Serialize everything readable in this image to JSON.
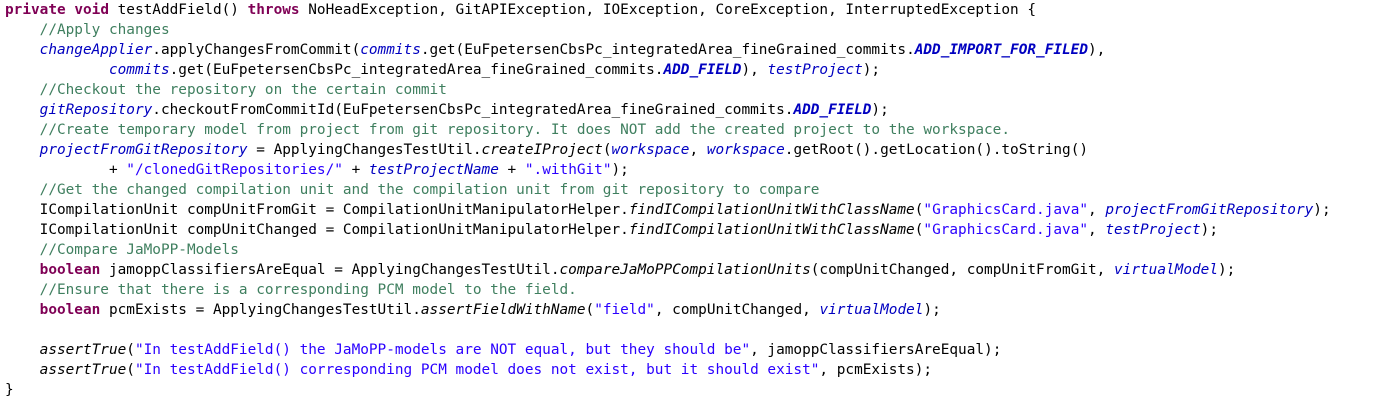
{
  "code_lines": [
    [
      [
        "kw",
        "private"
      ],
      [
        "pl",
        " "
      ],
      [
        "kw",
        "void"
      ],
      [
        "pl",
        " testAddField() "
      ],
      [
        "kw",
        "throws"
      ],
      [
        "pl",
        " NoHeadException, GitAPIException, IOException, CoreException, InterruptedException {"
      ]
    ],
    [
      [
        "pl",
        "    "
      ],
      [
        "cm",
        "//Apply changes"
      ]
    ],
    [
      [
        "pl",
        "    "
      ],
      [
        "fd",
        "changeApplier"
      ],
      [
        "pl",
        ".applyChangesFromCommit("
      ],
      [
        "fd",
        "commits"
      ],
      [
        "pl",
        ".get(EuFpetersenCbsPc_integratedArea_fineGrained_commits."
      ],
      [
        "sf",
        "ADD_IMPORT_FOR_FILED"
      ],
      [
        "pl",
        "),"
      ]
    ],
    [
      [
        "pl",
        "            "
      ],
      [
        "fd",
        "commits"
      ],
      [
        "pl",
        ".get(EuFpetersenCbsPc_integratedArea_fineGrained_commits."
      ],
      [
        "sf",
        "ADD_FIELD"
      ],
      [
        "pl",
        "), "
      ],
      [
        "fd",
        "testProject"
      ],
      [
        "pl",
        ");"
      ]
    ],
    [
      [
        "pl",
        "    "
      ],
      [
        "cm",
        "//Checkout the repository on the certain commit"
      ]
    ],
    [
      [
        "pl",
        "    "
      ],
      [
        "fd",
        "gitRepository"
      ],
      [
        "pl",
        ".checkoutFromCommitId(EuFpetersenCbsPc_integratedArea_fineGrained_commits."
      ],
      [
        "sf",
        "ADD_FIELD"
      ],
      [
        "pl",
        ");"
      ]
    ],
    [
      [
        "pl",
        "    "
      ],
      [
        "cm",
        "//Create temporary model from project from git repository. It does NOT add the created project to the workspace."
      ]
    ],
    [
      [
        "pl",
        "    "
      ],
      [
        "fd",
        "projectFromGitRepository"
      ],
      [
        "pl",
        " = ApplyingChangesTestUtil."
      ],
      [
        "sm",
        "createIProject"
      ],
      [
        "pl",
        "("
      ],
      [
        "fd",
        "workspace"
      ],
      [
        "pl",
        ", "
      ],
      [
        "fd",
        "workspace"
      ],
      [
        "pl",
        ".getRoot().getLocation().toString()"
      ]
    ],
    [
      [
        "pl",
        "            + "
      ],
      [
        "st",
        "\"/clonedGitRepositories/\""
      ],
      [
        "pl",
        " + "
      ],
      [
        "fd",
        "testProjectName"
      ],
      [
        "pl",
        " + "
      ],
      [
        "st",
        "\".withGit\""
      ],
      [
        "pl",
        ");"
      ]
    ],
    [
      [
        "pl",
        "    "
      ],
      [
        "cm",
        "//Get the changed compilation unit and the compilation unit from git repository to compare"
      ]
    ],
    [
      [
        "pl",
        "    ICompilationUnit compUnitFromGit = CompilationUnitManipulatorHelper."
      ],
      [
        "sm",
        "findICompilationUnitWithClassName"
      ],
      [
        "pl",
        "("
      ],
      [
        "st",
        "\"GraphicsCard.java\""
      ],
      [
        "pl",
        ", "
      ],
      [
        "fd",
        "projectFromGitRepository"
      ],
      [
        "pl",
        ");"
      ]
    ],
    [
      [
        "pl",
        "    ICompilationUnit compUnitChanged = CompilationUnitManipulatorHelper."
      ],
      [
        "sm",
        "findICompilationUnitWithClassName"
      ],
      [
        "pl",
        "("
      ],
      [
        "st",
        "\"GraphicsCard.java\""
      ],
      [
        "pl",
        ", "
      ],
      [
        "fd",
        "testProject"
      ],
      [
        "pl",
        ");"
      ]
    ],
    [
      [
        "pl",
        "    "
      ],
      [
        "cm",
        "//Compare JaMoPP-Models"
      ]
    ],
    [
      [
        "pl",
        "    "
      ],
      [
        "kw",
        "boolean"
      ],
      [
        "pl",
        " jamoppClassifiersAreEqual = ApplyingChangesTestUtil."
      ],
      [
        "sm",
        "compareJaMoPPCompilationUnits"
      ],
      [
        "pl",
        "(compUnitChanged, compUnitFromGit, "
      ],
      [
        "fd",
        "virtualModel"
      ],
      [
        "pl",
        ");"
      ]
    ],
    [
      [
        "pl",
        "    "
      ],
      [
        "cm",
        "//Ensure that there is a corresponding PCM model to the field."
      ]
    ],
    [
      [
        "pl",
        "    "
      ],
      [
        "kw",
        "boolean"
      ],
      [
        "pl",
        " pcmExists = ApplyingChangesTestUtil."
      ],
      [
        "sm",
        "assertFieldWithName"
      ],
      [
        "pl",
        "("
      ],
      [
        "st",
        "\"field\""
      ],
      [
        "pl",
        ", compUnitChanged, "
      ],
      [
        "fd",
        "virtualModel"
      ],
      [
        "pl",
        ");"
      ]
    ],
    [
      [
        "pl",
        " "
      ]
    ],
    [
      [
        "pl",
        "    "
      ],
      [
        "sm",
        "assertTrue"
      ],
      [
        "pl",
        "("
      ],
      [
        "st",
        "\"In testAddField() the JaMoPP-models are NOT equal, but they should be\""
      ],
      [
        "pl",
        ", jamoppClassifiersAreEqual);"
      ]
    ],
    [
      [
        "pl",
        "    "
      ],
      [
        "sm",
        "assertTrue"
      ],
      [
        "pl",
        "("
      ],
      [
        "st",
        "\"In testAddField() corresponding PCM model does not exist, but it should exist\""
      ],
      [
        "pl",
        ", pcmExists);"
      ]
    ],
    [
      [
        "pl",
        "}"
      ]
    ]
  ]
}
